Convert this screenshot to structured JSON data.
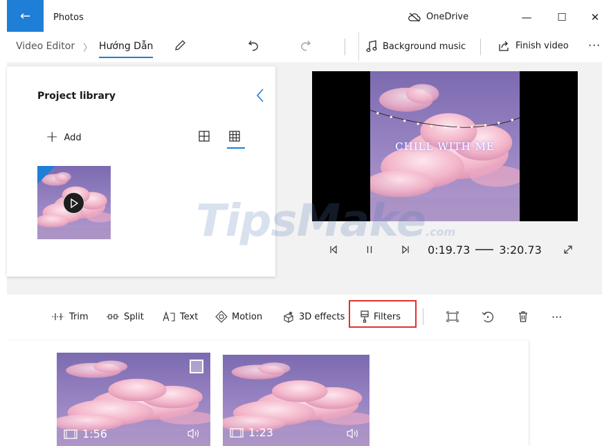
{
  "titlebar": {
    "back": "←",
    "app_title": "Photos",
    "onedrive": "OneDrive",
    "minimize": "—",
    "maximize": "☐",
    "close": "✕"
  },
  "commandbar": {
    "breadcrumb_root": "Video Editor",
    "breadcrumb_sep": "〉",
    "project_name": "Hướng Dẫn",
    "background_music": "Background music",
    "finish_video": "Finish video",
    "more": "···"
  },
  "library": {
    "title": "Project library",
    "add_label": "Add",
    "add_symbol": "+"
  },
  "preview": {
    "caption": "CHILL WITH ME",
    "current_time": "0:19.73",
    "total_time": "3:20.73"
  },
  "watermark": {
    "text": "TipsMake",
    "suffix": ".com"
  },
  "toolbar": {
    "trim": "Trim",
    "split": "Split",
    "text": "Text",
    "motion": "Motion",
    "effects3d": "3D effects",
    "filters": "Filters",
    "more": "···"
  },
  "storyboard": {
    "clips": [
      {
        "duration": "1:56"
      },
      {
        "duration": "1:23"
      }
    ]
  },
  "colors": {
    "accent": "#1f7ed6",
    "highlight": "#e0312f",
    "sky_top": "#8a7bb8",
    "sky_bottom": "#b89ac9",
    "cloud": "#f4b8c8"
  }
}
